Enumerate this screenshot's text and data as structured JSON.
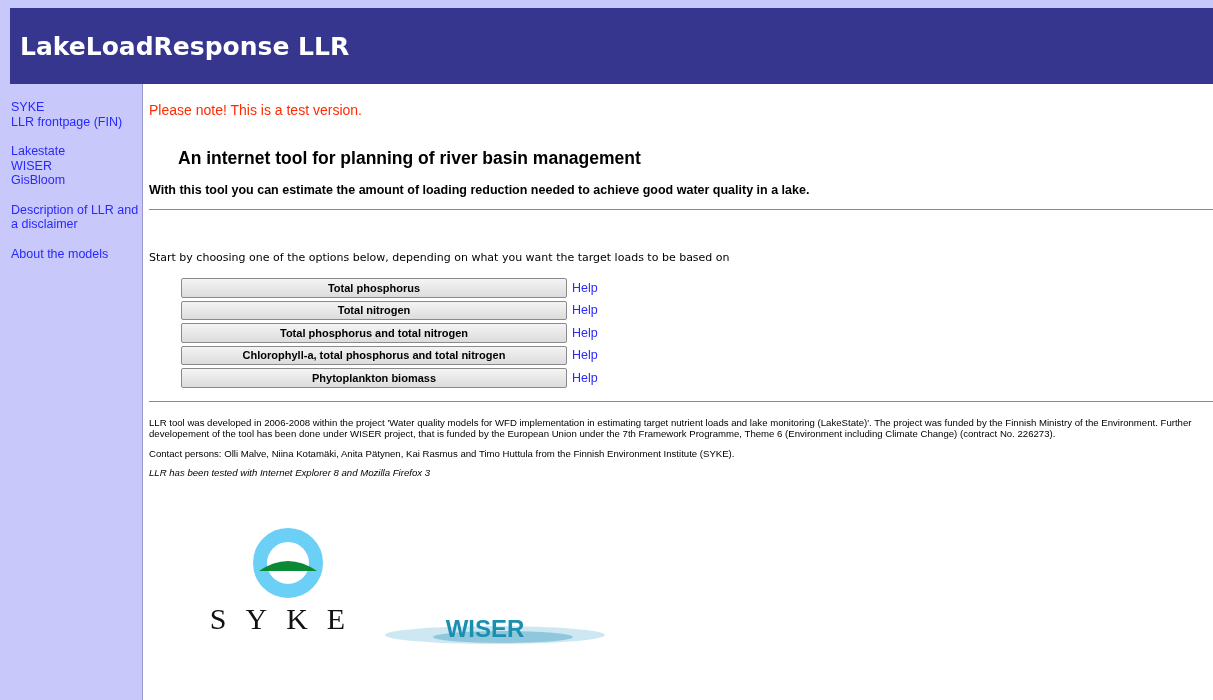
{
  "header": {
    "title": "LakeLoadResponse LLR"
  },
  "sidebar": {
    "groups": [
      {
        "links": [
          "SYKE",
          "LLR frontpage (FIN)"
        ]
      },
      {
        "links": [
          "Lakestate",
          "WISER",
          "GisBloom"
        ]
      },
      {
        "links": [
          "Description of LLR and a disclaimer"
        ]
      },
      {
        "links": [
          "About the models"
        ]
      }
    ]
  },
  "notice": "Please note! This is a test version.",
  "heading": "An internet tool for planning of river basin management",
  "subheading": "With this tool you can estimate the amount of loading reduction needed to achieve good water quality in a lake.",
  "instruction": "Start by choosing one of the options below, depending on what you want the target loads to be based on",
  "options": [
    {
      "label": "Total phosphorus",
      "help": "Help"
    },
    {
      "label": "Total nitrogen",
      "help": "Help"
    },
    {
      "label": "Total phosphorus and total nitrogen",
      "help": "Help"
    },
    {
      "label": "Chlorophyll-a, total phosphorus and total nitrogen",
      "help": "Help"
    },
    {
      "label": "Phytoplankton biomass",
      "help": "Help"
    }
  ],
  "footer": [
    {
      "kind": "plain",
      "text": "LLR tool was developed in 2006-2008 within the project 'Water quality models for WFD implementation in estimating target nutrient loads and lake monitoring (LakeState)'. The project was funded by the Finnish Ministry of the Environment. Further developement of the tool has been done under WISER project, that is funded by the European Union under the 7th Framework Programme, Theme 6 (Environment including Climate Change) (contract No. 226273)."
    },
    {
      "kind": "plain",
      "text": "Contact persons: Olli Malve, Niina Kotamäki, Anita Pätynen, Kai Rasmus and Timo Huttula from the Finnish Environment Institute (SYKE)."
    },
    {
      "kind": "italic",
      "text": "LLR has been tested with Internet Explorer 8 and Mozilla Firefox 3"
    }
  ],
  "logos": [
    {
      "kind": "syke",
      "text": "SYKE"
    },
    {
      "kind": "wiser",
      "text": "WISER"
    }
  ]
}
